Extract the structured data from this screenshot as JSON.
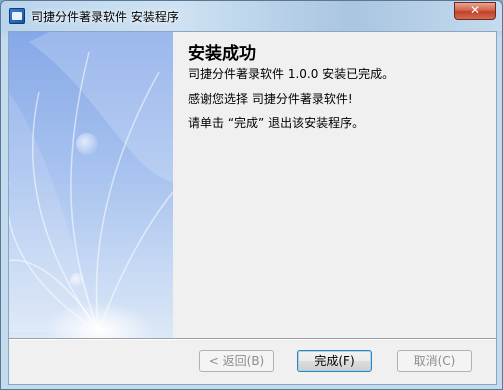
{
  "window": {
    "title": "司捷分件著录软件 安装程序",
    "close_glyph": "✕"
  },
  "content": {
    "heading": "安装成功",
    "line1": "司捷分件著录软件 1.0.0 安装已完成。",
    "line2": "感谢您选择 司捷分件著录软件!",
    "line3": "请单击 “完成” 退出该安装程序。"
  },
  "buttons": {
    "back_label": "< 返回(B)",
    "finish_label": "完成(F)",
    "cancel_label": "取消(C)"
  },
  "colors": {
    "banner_top": "#8fb0ea",
    "banner_bottom": "#d8e6f6",
    "close_red": "#c0422a"
  },
  "icons": {
    "app": "installer-app-icon",
    "close": "close-icon"
  }
}
